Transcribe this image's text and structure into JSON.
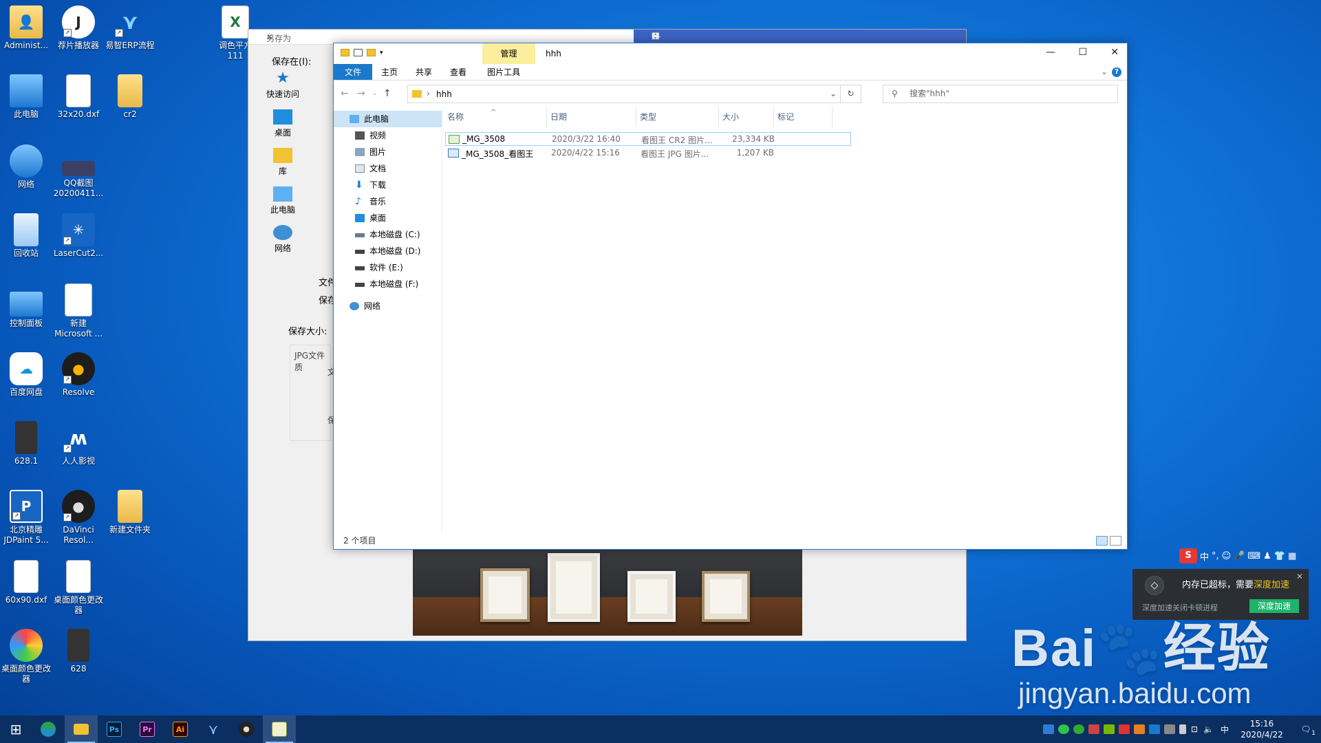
{
  "desktop_icons": [
    {
      "label": "Administ...",
      "icon": "user-folder-icon"
    },
    {
      "label": "荐片播放器",
      "icon": "jianpian-player-icon"
    },
    {
      "label": "易智ERP流程",
      "icon": "erp-icon"
    },
    {
      "label": "调色平方\n111",
      "icon": "excel-file-icon"
    },
    {
      "label": "此电脑",
      "icon": "this-pc-icon"
    },
    {
      "label": "32x20.dxf",
      "icon": "dxf-file-icon"
    },
    {
      "label": "cr2",
      "icon": "folder-icon"
    },
    {
      "label": "网络",
      "icon": "network-icon"
    },
    {
      "label": "QQ截图\n20200411...",
      "icon": "image-file-icon"
    },
    {
      "label": "回收站",
      "icon": "recycle-bin-icon"
    },
    {
      "label": "LaserCut2...",
      "icon": "lasercut-icon"
    },
    {
      "label": "控制面板",
      "icon": "control-panel-icon"
    },
    {
      "label": "新建\nMicrosoft ...",
      "icon": "word-file-icon"
    },
    {
      "label": "百度网盘",
      "icon": "baidu-netdisk-icon"
    },
    {
      "label": "Resolve",
      "icon": "davinci-resolve-icon"
    },
    {
      "label": "628.1",
      "icon": "image-file-icon"
    },
    {
      "label": "人人影视",
      "icon": "renren-icon"
    },
    {
      "label": "北京精雕\nJDPaint 5...",
      "icon": "jdpaint-icon"
    },
    {
      "label": "DaVinci\nResol...",
      "icon": "davinci-resolve-icon"
    },
    {
      "label": "新建文件夹",
      "icon": "folder-icon"
    },
    {
      "label": "60x90.dxf",
      "icon": "dxf-file-icon"
    },
    {
      "label": "桌面颜色更改\n器",
      "icon": "settings-file-icon"
    },
    {
      "label": "桌面颜色更改\n器",
      "icon": "color-changer-icon"
    },
    {
      "label": "628",
      "icon": "image-file-icon"
    }
  ],
  "save_dialog": {
    "title": "另存为",
    "save_in_label": "保存在(I):",
    "places": [
      "快速访问",
      "桌面",
      "库",
      "此电脑",
      "网络"
    ],
    "left_labels": [
      "文件",
      "保存"
    ],
    "save_size_label": "保存大小:",
    "jpg_quality_label": "JPG文件质",
    "cut_label_1": "文",
    "cut_label_2": "保"
  },
  "explorer": {
    "manage_tab": "管理",
    "title": "hhh",
    "ribbon_tabs": [
      "文件",
      "主页",
      "共享",
      "查看",
      "图片工具"
    ],
    "path": "hhh",
    "search_placeholder": "搜索\"hhh\"",
    "columns": [
      "名称",
      "日期",
      "类型",
      "大小",
      "标记"
    ],
    "nav": {
      "top": "此电脑",
      "items": [
        "视频",
        "图片",
        "文档",
        "下载",
        "音乐",
        "桌面",
        "本地磁盘 (C:)",
        "本地磁盘 (D:)",
        "软件 (E:)",
        "本地磁盘 (F:)"
      ],
      "network": "网络"
    },
    "files": [
      {
        "name": "_MG_3508",
        "date": "2020/3/22 16:40",
        "type": "看图王 CR2 图片...",
        "size": "23,334 KB"
      },
      {
        "name": "_MG_3508_看图王",
        "date": "2020/4/22 15:16",
        "type": "看图王 JPG 图片...",
        "size": "1,207 KB"
      }
    ],
    "status": "2 个项目"
  },
  "popup": {
    "message": "内存已超标，需要",
    "highlight": "深度加速",
    "sub": "深度加速关闭卡顿进程",
    "button": "深度加速"
  },
  "ime": {
    "lang": "中",
    "punct": "°,"
  },
  "watermark": {
    "line1": "Bai🐾经验",
    "line2": "jingyan.baidu.com"
  },
  "taskbar": {
    "apps": [
      "start-icon",
      "edge-icon",
      "file-explorer-icon",
      "photoshop-icon",
      "premiere-icon",
      "illustrator-icon",
      "erp-icon",
      "davinci-resolve-icon",
      "notepad-icon"
    ],
    "ps": "Ps",
    "pr": "Pr",
    "ai": "Ai",
    "lang": "中",
    "time": "15:16",
    "date": "2020/4/22",
    "notif_count": "1"
  },
  "colors": {
    "accent": "#1979ca",
    "manage_tab": "#fbee9c",
    "selected_row": "#99d1ff",
    "popup_btn": "#1fb36b"
  }
}
